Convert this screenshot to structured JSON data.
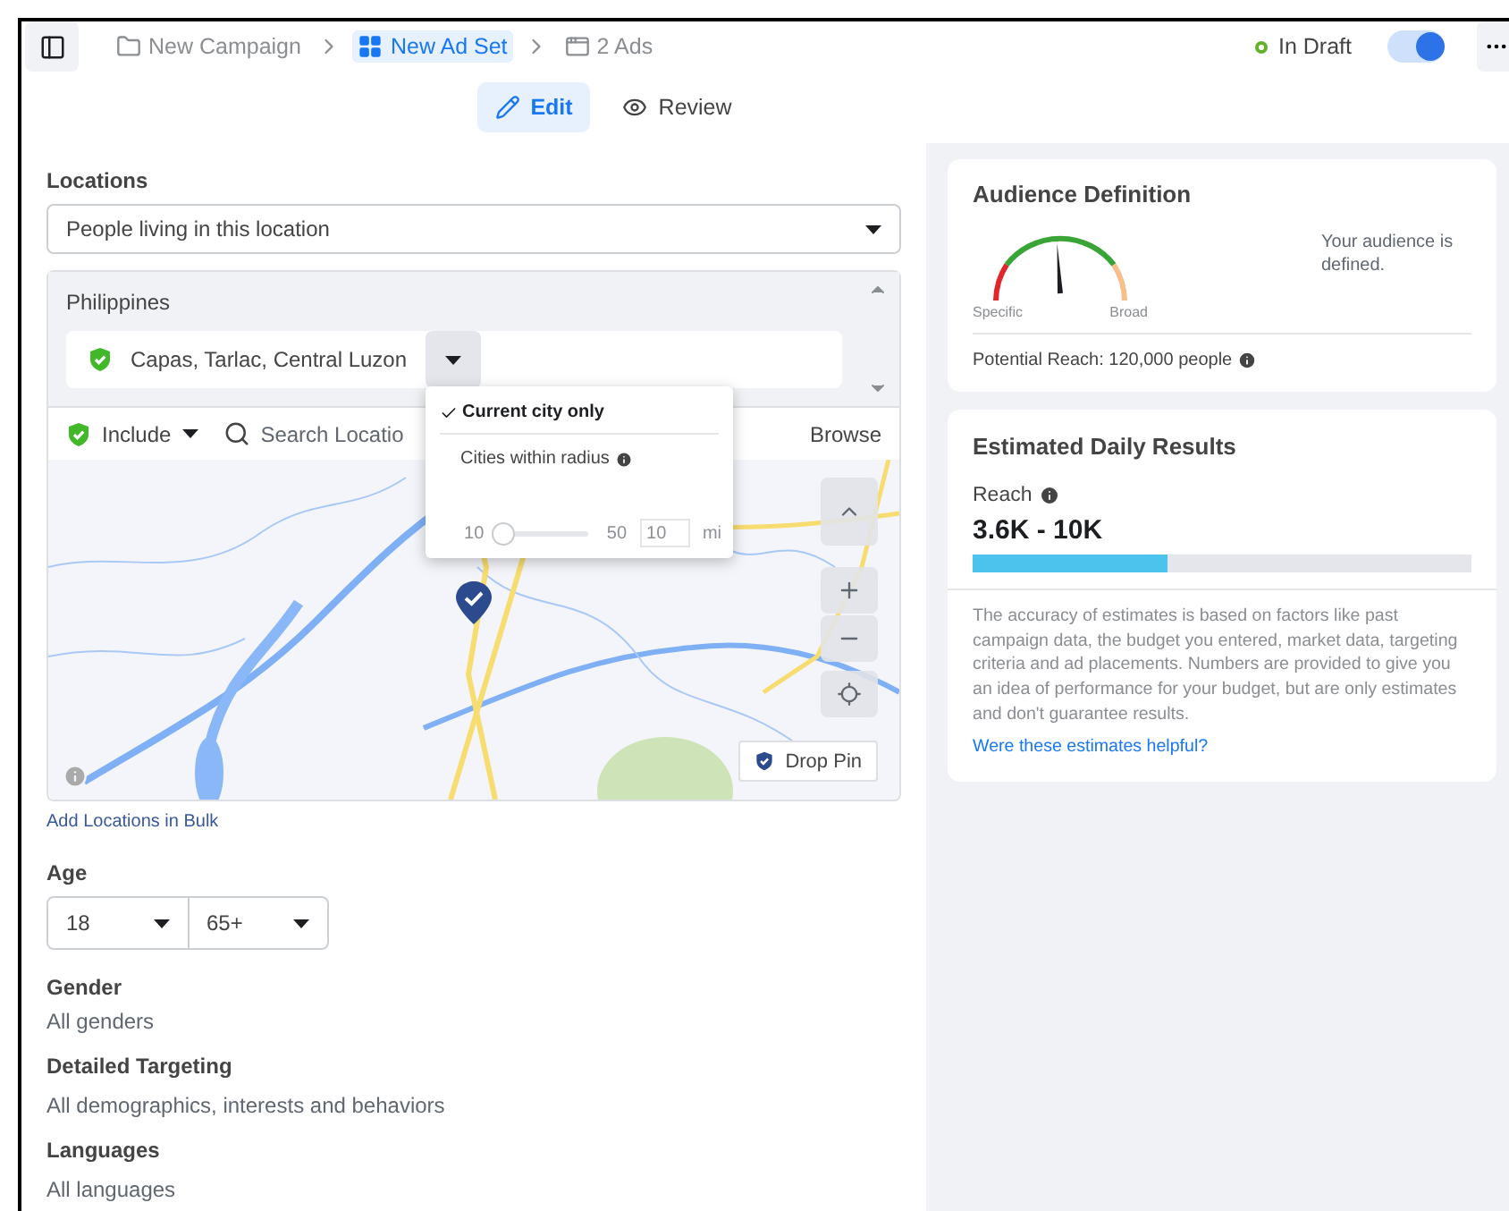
{
  "topbar": {
    "breadcrumbs": [
      {
        "label": "New Campaign",
        "kind": "campaign",
        "selected": false
      },
      {
        "label": "New Ad Set",
        "kind": "adset",
        "selected": true
      },
      {
        "label": "2 Ads",
        "kind": "ads",
        "selected": false
      }
    ],
    "status": {
      "label": "In Draft",
      "on": true
    }
  },
  "mode_tabs": [
    {
      "label": "Edit",
      "kind": "edit",
      "selected": true
    },
    {
      "label": "Review",
      "kind": "review",
      "selected": false
    }
  ],
  "locations": {
    "label": "Locations",
    "audience_type": "People living in this location",
    "country": "Philippines",
    "selected_location": "Capas, Tarlac, Central Luzon",
    "include": "Include",
    "search_placeholder": "Search Locatio",
    "browse": "Browse",
    "add_bulk": "Add Locations in Bulk",
    "radius_menu": {
      "options": [
        {
          "label": "Current city only",
          "selected": true,
          "info": false
        },
        {
          "label": "Cities within radius",
          "selected": false,
          "info": true
        }
      ],
      "slider": {
        "min": "10",
        "max": "50",
        "value": "10",
        "unit": "mi",
        "level": 0,
        "disabled": true
      }
    },
    "map": {
      "drop_pin": "Drop Pin"
    }
  },
  "age": {
    "label": "Age",
    "min": "18",
    "max": "65+"
  },
  "fields": [
    {
      "label": "Gender",
      "value": "All genders"
    },
    {
      "label": "Detailed Targeting",
      "value": "All demographics, interests and behaviors"
    },
    {
      "label": "Languages",
      "value": "All languages"
    }
  ],
  "audience_definition": {
    "title": "Audience Definition",
    "level": 0.48,
    "specific": "Specific",
    "broad": "Broad",
    "message": "Your audience is defined.",
    "potential_reach": "Potential Reach: 120,000 people"
  },
  "estimated_results": {
    "title": "Estimated Daily Results",
    "metric": "Reach",
    "range": "3.6K - 10K",
    "level": 0.39,
    "disclaimer": "The accuracy of estimates is based on factors like past campaign data, the budget you entered, market data, targeting criteria and ad placements. Numbers are provided to give you an idea of performance for your budget, but are only estimates and don't guarantee results.",
    "feedback_link": "Were these estimates helpful?"
  }
}
